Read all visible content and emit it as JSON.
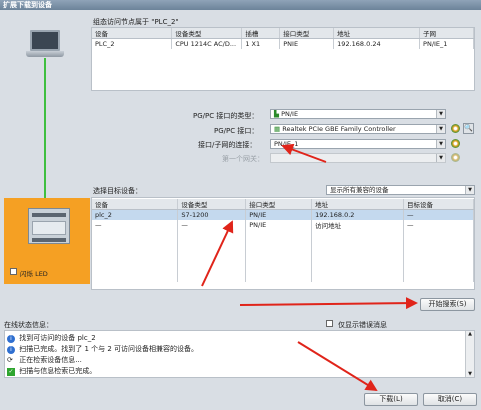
{
  "window": {
    "title": "扩展下载到设备"
  },
  "node_section": {
    "heading": "组态访问节点属于 \"PLC_2\"",
    "columns": [
      "设备",
      "设备类型",
      "插槽",
      "接口类型",
      "地址",
      "子网"
    ],
    "rows": [
      [
        "PLC_2",
        "CPU 1214C AC/D...",
        "1 X1",
        "PNIE",
        "192.168.0.24",
        "PN/IE_1"
      ]
    ]
  },
  "pgpc": {
    "type_label": "PG/PC 接口的类型：",
    "type_value": "PN/IE",
    "iface_label": "PG/PC 接口：",
    "iface_value": "Realtek PCIe GBE Family Controller",
    "conn_label": "接口/子网的连接：",
    "conn_value": "PN/IE_1",
    "gateway_label": "第一个网关："
  },
  "target": {
    "heading": "选择目标设备：",
    "filter_value": "显示所有兼容的设备",
    "columns": [
      "设备",
      "设备类型",
      "接口类型",
      "地址",
      "目标设备"
    ],
    "rows": [
      [
        "plc_2",
        "S7-1200",
        "PN/IE",
        "192.168.0.2",
        "—"
      ],
      [
        "—",
        "—",
        "PN/IE",
        "访问地址",
        "—"
      ]
    ]
  },
  "flash_led": "闪烁 LED",
  "start_search_btn": "开始搜索(S)",
  "status": {
    "heading": "在线状态信息：",
    "only_errors": "仅显示错误消息",
    "messages": [
      {
        "icon": "info",
        "text": "找到可访问的设备 plc_2"
      },
      {
        "icon": "info",
        "text": "扫描已完成。找到了 1 个与 2 可访问设备相兼容的设备。"
      },
      {
        "icon": "search",
        "text": "正在检索设备信息..."
      },
      {
        "icon": "ok",
        "text": "扫描与信息检索已完成。"
      }
    ]
  },
  "buttons": {
    "download": "下载(L)",
    "cancel": "取消(C)"
  },
  "colors": {
    "orange": "#f5a023",
    "green": "#3fbf3f",
    "arrow": "#e0241a",
    "select": "#c4d9ee"
  }
}
